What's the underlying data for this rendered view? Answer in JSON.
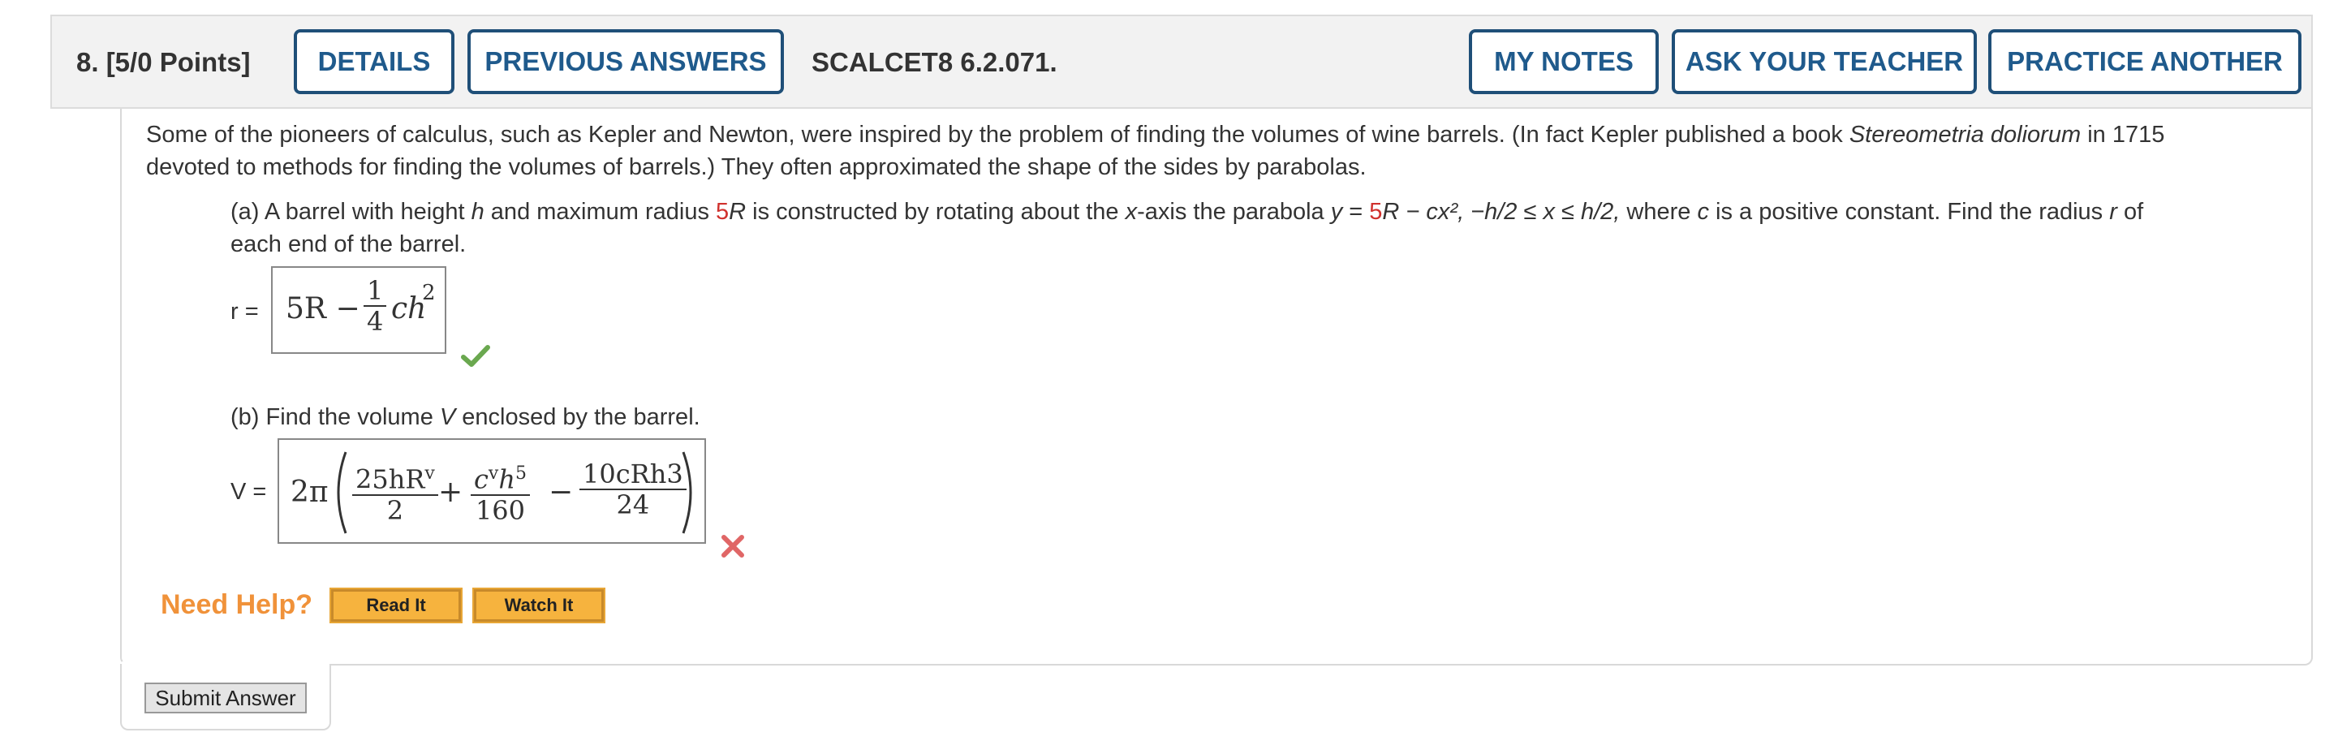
{
  "header": {
    "question_label": "8.  [5/0 Points]",
    "details_label": "DETAILS",
    "previous_answers_label": "PREVIOUS ANSWERS",
    "problem_code": "SCALCET8 6.2.071.",
    "my_notes_label": "MY NOTES",
    "ask_teacher_label": "ASK YOUR TEACHER",
    "practice_another_label": "PRACTICE ANOTHER"
  },
  "intro": {
    "line1_pre": "Some of the pioneers of calculus, such as Kepler and Newton, were inspired by the problem of finding the volumes of wine barrels. (In fact Kepler published a book ",
    "book_title": "Stereometria doliorum",
    "line1_post": " in 1715",
    "line2": "devoted to methods for finding the volumes of barrels.) They often approximated the shape of the sides by parabolas."
  },
  "part_a": {
    "t1": "(a) A barrel with height ",
    "h": "h",
    "t2": " and maximum radius  ",
    "five": "5",
    "R": "R",
    "t3": "  is constructed by rotating about the ",
    "x": "x",
    "t4": "-axis the parabola  ",
    "eq_y": "y",
    "eq_eq": " = ",
    "eq_five": "5",
    "eq_rest": "R − cx², −h/2 ≤ x ≤ h/2,",
    "t5": "  where ",
    "c": "c",
    "t6": " is a positive constant. Find the radius ",
    "r": "r",
    "t7": " of",
    "line2": "each end of the barrel.",
    "answer_label": "r =",
    "ans_lead": "5R −",
    "ans_num": "1",
    "ans_den": "4",
    "ans_tail": "ch",
    "ans_exp": "2"
  },
  "part_b": {
    "t1": "(b) Find the volume ",
    "V": "V",
    "t2": " enclosed by the barrel.",
    "answer_label": "V =",
    "two_pi": "2π",
    "f1_num": "25hR",
    "f1_num_sup": "v",
    "f1_den": "2",
    "plus": "+",
    "f2_num_c": "c",
    "f2_num_sup1": "v",
    "f2_num_h": "h",
    "f2_num_sup2": "5",
    "f2_den": "160",
    "minus": "−",
    "f3_num": "10cRh3",
    "f3_den": "24"
  },
  "help": {
    "label": "Need Help?",
    "read_label": "Read It",
    "watch_label": "Watch It"
  },
  "submit_label": "Submit Answer",
  "colors": {
    "accent_blue": "#1f5a8c",
    "correct_green": "#6aa84f",
    "incorrect_red": "#e06666",
    "help_orange": "#f0923a"
  }
}
